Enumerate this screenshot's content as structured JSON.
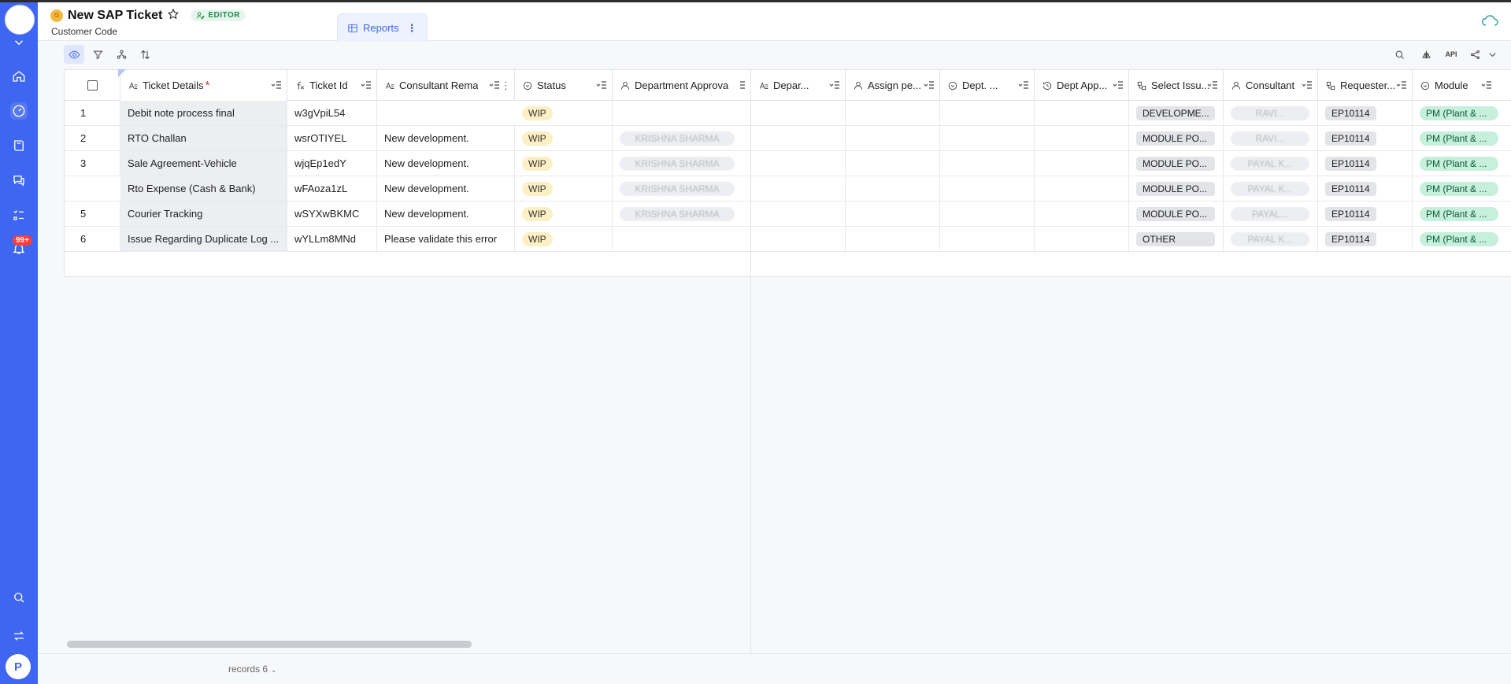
{
  "header": {
    "title": "New SAP Ticket",
    "editor_badge": "EDITOR",
    "subtitle": "Customer Code",
    "tab_reports": "Reports"
  },
  "sidebar": {
    "badge": "99+",
    "avatar": "P"
  },
  "columns": [
    {
      "label": "Ticket Details",
      "required": "*"
    },
    {
      "label": "Ticket Id"
    },
    {
      "label": "Consultant Rema"
    },
    {
      "label": "Status"
    },
    {
      "label": "Department Approva"
    },
    {
      "label": "Depar..."
    },
    {
      "label": "Assign pe..."
    },
    {
      "label": "Dept. ..."
    },
    {
      "label": "Dept App..."
    },
    {
      "label": "Select Issu..."
    },
    {
      "label": "Consultant"
    },
    {
      "label": "Requester..."
    },
    {
      "label": "Module"
    }
  ],
  "rows": [
    {
      "num": "1",
      "details": "Debit note process final",
      "id": "w3gVpiL54",
      "remark": "",
      "status": "WIP",
      "dept_approval": "",
      "issue": "DEVELOPME...",
      "consultant": "RAVI...",
      "requester": "EP10114",
      "module": "PM (Plant & ..."
    },
    {
      "num": "2",
      "details": "RTO Challan",
      "id": "wsrOTIYEL",
      "remark": "New development.",
      "status": "WIP",
      "dept_approval": "KRISHNA SHARMA",
      "issue": "MODULE PO...",
      "consultant": "RAVI...",
      "requester": "EP10114",
      "module": "PM (Plant & ..."
    },
    {
      "num": "3",
      "details": "Sale Agreement-Vehicle",
      "id": "wjqEp1edY",
      "remark": "New development.",
      "status": "WIP",
      "dept_approval": "KRISHNA SHARMA",
      "issue": "MODULE PO...",
      "consultant": "PAYAL K...",
      "requester": "EP10114",
      "module": "PM (Plant & ..."
    },
    {
      "num": "",
      "details": "Rto Expense (Cash & Bank)",
      "id": "wFAoza1zL",
      "remark": "New development.",
      "status": "WIP",
      "dept_approval": "KRISHNA SHARMA",
      "issue": "MODULE PO...",
      "consultant": "PAYAL K...",
      "requester": "EP10114",
      "module": "PM (Plant & ..."
    },
    {
      "num": "5",
      "details": "Courier Tracking",
      "id": "wSYXwBKMC",
      "remark": "New development.",
      "status": "WIP",
      "dept_approval": "KRISHNA SHARMA",
      "issue": "MODULE PO...",
      "consultant": "PAYAL...",
      "requester": "EP10114",
      "module": "PM (Plant & ..."
    },
    {
      "num": "6",
      "details": "Issue Regarding Duplicate Log ...",
      "id": "wYLLm8MNd",
      "remark": "Please validate this error",
      "status": "WIP",
      "dept_approval": "",
      "issue": "OTHER",
      "consultant": "PAYAL K...",
      "requester": "EP10114",
      "module": "PM (Plant & ..."
    }
  ],
  "footer": {
    "records": "records 6"
  }
}
